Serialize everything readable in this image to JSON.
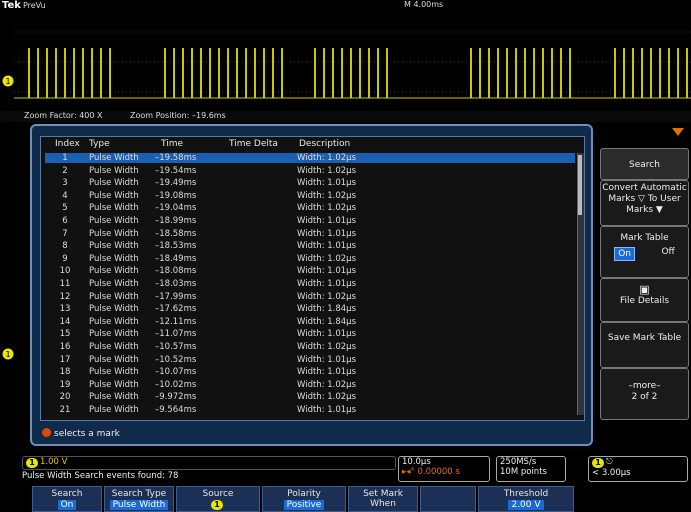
{
  "header": {
    "brand": "Tek",
    "mode": "PreVu",
    "timebase": "M 4.00ms"
  },
  "zoom": {
    "factor": "Zoom Factor: 400 X",
    "position": "Zoom Position: –19.6ms"
  },
  "table": {
    "columns": [
      "Index",
      "Type",
      "Time",
      "Time Delta",
      "Description"
    ],
    "rows": [
      [
        "1",
        "Pulse Width",
        "–19.58ms",
        "",
        "Width: 1.02µs"
      ],
      [
        "2",
        "Pulse Width",
        "–19.54ms",
        "",
        "Width: 1.02µs"
      ],
      [
        "3",
        "Pulse Width",
        "–19.49ms",
        "",
        "Width: 1.01µs"
      ],
      [
        "4",
        "Pulse Width",
        "–19.08ms",
        "",
        "Width: 1.02µs"
      ],
      [
        "5",
        "Pulse Width",
        "–19.04ms",
        "",
        "Width: 1.02µs"
      ],
      [
        "6",
        "Pulse Width",
        "–18.99ms",
        "",
        "Width: 1.01µs"
      ],
      [
        "7",
        "Pulse Width",
        "–18.58ms",
        "",
        "Width: 1.01µs"
      ],
      [
        "8",
        "Pulse Width",
        "–18.53ms",
        "",
        "Width: 1.01µs"
      ],
      [
        "9",
        "Pulse Width",
        "–18.49ms",
        "",
        "Width: 1.02µs"
      ],
      [
        "10",
        "Pulse Width",
        "–18.08ms",
        "",
        "Width: 1.01µs"
      ],
      [
        "11",
        "Pulse Width",
        "–18.03ms",
        "",
        "Width: 1.01µs"
      ],
      [
        "12",
        "Pulse Width",
        "–17.99ms",
        "",
        "Width: 1.02µs"
      ],
      [
        "13",
        "Pulse Width",
        "–17.62ms",
        "",
        "Width: 1.84µs"
      ],
      [
        "14",
        "Pulse Width",
        "–12.11ms",
        "",
        "Width: 1.84µs"
      ],
      [
        "15",
        "Pulse Width",
        "–11.07ms",
        "",
        "Width: 1.01µs"
      ],
      [
        "16",
        "Pulse Width",
        "–10.57ms",
        "",
        "Width: 1.02µs"
      ],
      [
        "17",
        "Pulse Width",
        "–10.52ms",
        "",
        "Width: 1.01µs"
      ],
      [
        "18",
        "Pulse Width",
        "–10.07ms",
        "",
        "Width: 1.01µs"
      ],
      [
        "19",
        "Pulse Width",
        "–10.02ms",
        "",
        "Width: 1.02µs"
      ],
      [
        "20",
        "Pulse Width",
        "–9.972ms",
        "",
        "Width: 1.02µs"
      ],
      [
        "21",
        "Pulse Width",
        "–9.564ms",
        "",
        "Width: 1.01µs"
      ]
    ],
    "hint": "selects a mark"
  },
  "side_menu": {
    "search": "Search",
    "convert": "Convert Automatic Marks ▽ To User Marks ▼",
    "mark_table": "Mark Table",
    "on": "On",
    "off": "Off",
    "file_details": "File Details",
    "save": "Save Mark Table",
    "more": "–more–",
    "more_page": "2 of 2"
  },
  "status": {
    "ch1_scale": "1.00 V",
    "events": "Pulse Width Search events found: 78",
    "horiz_scale": "10.0µs",
    "horiz_pos": "▸◂° 0.00000 s",
    "sample_rate": "250MS/s",
    "record_length": "10M points",
    "trigger": "< 3.00µs"
  },
  "bottom_buttons": [
    {
      "label": "Search",
      "value": "On"
    },
    {
      "label": "Search Type",
      "value": "Pulse Width"
    },
    {
      "label": "Source",
      "value": "1"
    },
    {
      "label": "Polarity",
      "value": "Positive"
    },
    {
      "label": "Set Mark When",
      "value": ""
    },
    {
      "label": "",
      "value": ""
    },
    {
      "label": "Threshold",
      "value": "2.00 V"
    }
  ],
  "colors": {
    "ch1": "#e6e600",
    "accent": "#1a6bd6",
    "panel": "#0f2a4a"
  }
}
